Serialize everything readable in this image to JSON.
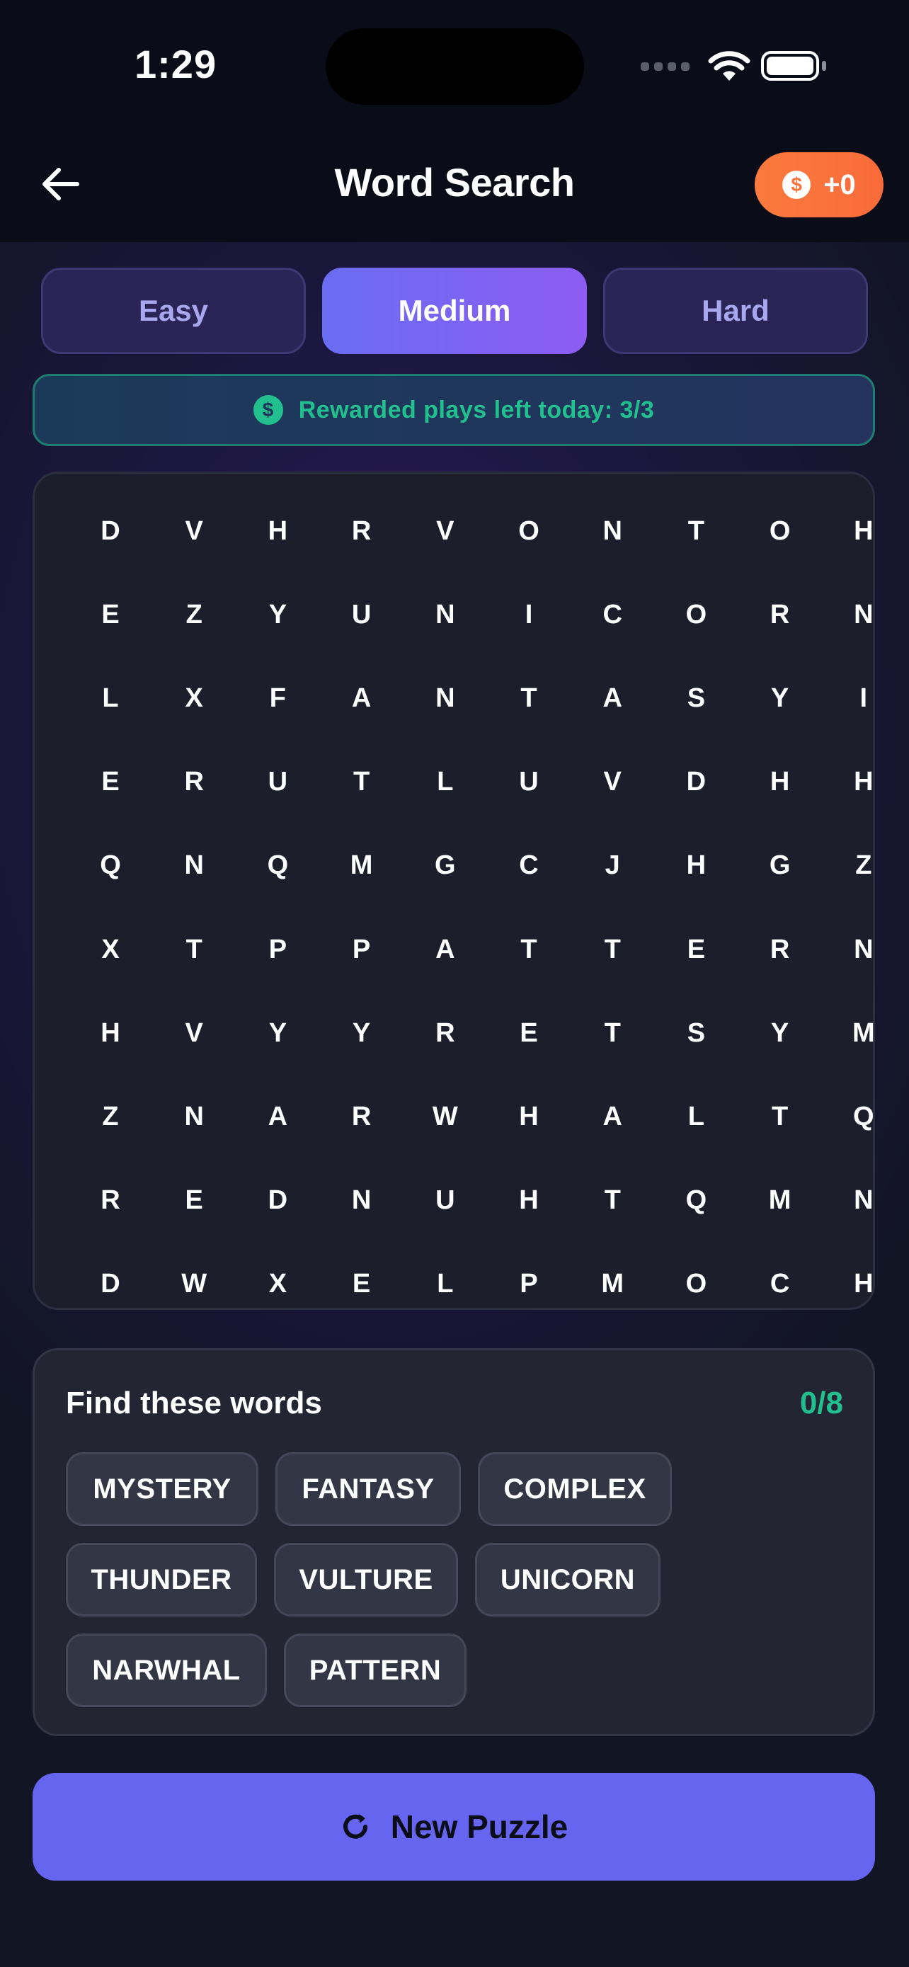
{
  "status_bar": {
    "time": "1:29"
  },
  "header": {
    "back_icon": "arrow-left-icon",
    "title": "Word Search",
    "coins_icon": "dollar-coin-icon",
    "coins": "+0"
  },
  "difficulty": {
    "options": [
      "Easy",
      "Medium",
      "Hard"
    ],
    "selected": "Medium"
  },
  "reward_banner": {
    "icon": "dollar-coin-icon",
    "text": "Rewarded plays left today: 3/3"
  },
  "grid": {
    "rows": [
      [
        "D",
        "V",
        "H",
        "R",
        "V",
        "O",
        "N",
        "T",
        "O",
        "H"
      ],
      [
        "E",
        "Z",
        "Y",
        "U",
        "N",
        "I",
        "C",
        "O",
        "R",
        "N"
      ],
      [
        "L",
        "X",
        "F",
        "A",
        "N",
        "T",
        "A",
        "S",
        "Y",
        "I"
      ],
      [
        "E",
        "R",
        "U",
        "T",
        "L",
        "U",
        "V",
        "D",
        "H",
        "H"
      ],
      [
        "Q",
        "N",
        "Q",
        "M",
        "G",
        "C",
        "J",
        "H",
        "G",
        "Z"
      ],
      [
        "X",
        "T",
        "P",
        "P",
        "A",
        "T",
        "T",
        "E",
        "R",
        "N"
      ],
      [
        "H",
        "V",
        "Y",
        "Y",
        "R",
        "E",
        "T",
        "S",
        "Y",
        "M"
      ],
      [
        "Z",
        "N",
        "A",
        "R",
        "W",
        "H",
        "A",
        "L",
        "T",
        "Q"
      ],
      [
        "R",
        "E",
        "D",
        "N",
        "U",
        "H",
        "T",
        "Q",
        "M",
        "N"
      ],
      [
        "D",
        "W",
        "X",
        "E",
        "L",
        "P",
        "M",
        "O",
        "C",
        "H"
      ]
    ]
  },
  "words_panel": {
    "title": "Find these words",
    "progress": "0/8",
    "words": [
      "MYSTERY",
      "FANTASY",
      "COMPLEX",
      "THUNDER",
      "VULTURE",
      "UNICORN",
      "NARWHAL",
      "PATTERN"
    ]
  },
  "new_puzzle": {
    "icon": "refresh-icon",
    "label": "New Puzzle"
  },
  "colors": {
    "accent": "#6565ef",
    "coins": "#fb7a3d",
    "success": "#22c08e"
  }
}
